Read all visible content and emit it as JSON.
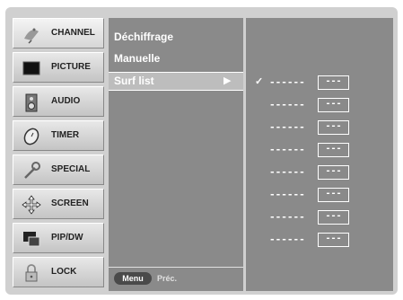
{
  "menu": [
    {
      "label": "CHANNEL",
      "icon": "satellite-dish-icon",
      "active": true
    },
    {
      "label": "PICTURE",
      "icon": "tv-screen-icon"
    },
    {
      "label": "AUDIO",
      "icon": "speaker-icon"
    },
    {
      "label": "TIMER",
      "icon": "clock-icon"
    },
    {
      "label": "SPECIAL",
      "icon": "wrench-icon"
    },
    {
      "label": "SCREEN",
      "icon": "move-arrows-icon"
    },
    {
      "label": "PIP/DW",
      "icon": "pip-windows-icon"
    },
    {
      "label": "LOCK",
      "icon": "padlock-icon"
    }
  ],
  "submenu": {
    "items": [
      "Déchiffrage",
      "Manuelle",
      "Surf list"
    ],
    "selected_index": 2,
    "arrow": "▶",
    "menu_button": "Menu",
    "back_label": "Préc."
  },
  "surf_list": {
    "check": "✓",
    "dash": "------",
    "box": "---",
    "rows": 8,
    "checked_row": 0
  },
  "colors": {
    "background": "#d0d0d0",
    "panel": "#8a8a8a",
    "selected": "#bdbdbd",
    "text": "#ffffff"
  }
}
